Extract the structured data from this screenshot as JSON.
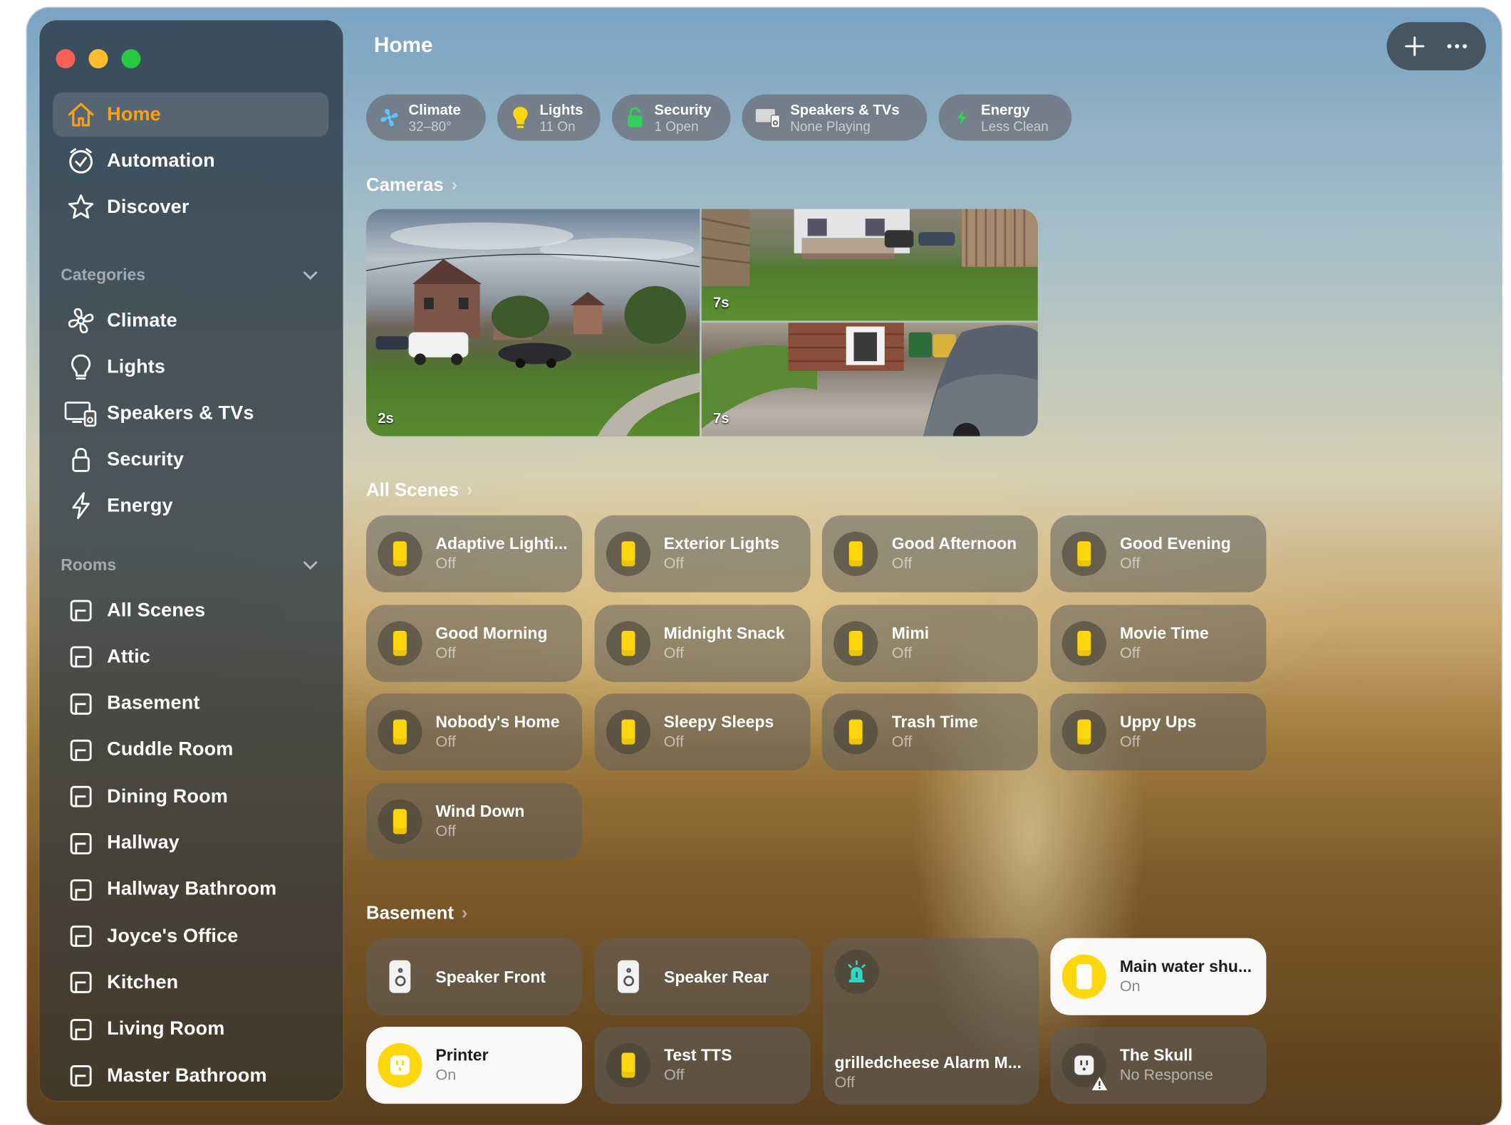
{
  "window": {
    "title": "Home"
  },
  "colors": {
    "accent": "#ff9f0a",
    "scene_bulb": "#ffd60a",
    "close": "#ff5f57",
    "minimize": "#febc2e",
    "zoom": "#28c840"
  },
  "toolbar": {
    "add_icon": "plus-icon",
    "more_icon": "ellipsis-icon"
  },
  "sidebar": {
    "main": [
      {
        "label": "Home",
        "icon": "house-icon"
      },
      {
        "label": "Automation",
        "icon": "clock-check-icon"
      },
      {
        "label": "Discover",
        "icon": "star-icon"
      }
    ],
    "categories_header": "Categories",
    "categories": [
      {
        "label": "Climate",
        "icon": "fan-icon"
      },
      {
        "label": "Lights",
        "icon": "bulb-icon"
      },
      {
        "label": "Speakers & TVs",
        "icon": "tv-speaker-icon"
      },
      {
        "label": "Security",
        "icon": "lock-icon"
      },
      {
        "label": "Energy",
        "icon": "bolt-icon"
      }
    ],
    "rooms_header": "Rooms",
    "rooms": [
      "All Scenes",
      "Attic",
      "Basement",
      "Cuddle Room",
      "Dining Room",
      "Hallway",
      "Hallway Bathroom",
      "Joyce's Office",
      "Kitchen",
      "Living Room",
      "Master Bathroom"
    ]
  },
  "summary": [
    {
      "title": "Climate",
      "status": "32–80°",
      "icon": "fan-icon"
    },
    {
      "title": "Lights",
      "status": "11 On",
      "icon": "bulb-icon"
    },
    {
      "title": "Security",
      "status": "1 Open",
      "icon": "lock-icon"
    },
    {
      "title": "Speakers & TVs",
      "status": "None Playing",
      "icon": "tv-speaker-icon"
    },
    {
      "title": "Energy",
      "status": "Less Clean",
      "icon": "bolt-icon"
    }
  ],
  "cameras": {
    "header": "Cameras",
    "feeds": [
      {
        "age": "2s"
      },
      {
        "age": "7s"
      },
      {
        "age": "7s"
      }
    ]
  },
  "scenes": {
    "header": "All Scenes",
    "items": [
      {
        "name": "Adaptive Lighti...",
        "state": "Off"
      },
      {
        "name": "Exterior Lights",
        "state": "Off"
      },
      {
        "name": "Good Afternoon",
        "state": "Off"
      },
      {
        "name": "Good Evening",
        "state": "Off"
      },
      {
        "name": "Good Morning",
        "state": "Off"
      },
      {
        "name": "Midnight Snack",
        "state": "Off"
      },
      {
        "name": "Mimi",
        "state": "Off"
      },
      {
        "name": "Movie Time",
        "state": "Off"
      },
      {
        "name": "Nobody's Home",
        "state": "Off"
      },
      {
        "name": "Sleepy Sleeps",
        "state": "Off"
      },
      {
        "name": "Trash Time",
        "state": "Off"
      },
      {
        "name": "Uppy Ups",
        "state": "Off"
      },
      {
        "name": "Wind Down",
        "state": "Off"
      }
    ]
  },
  "basement": {
    "header": "Basement",
    "items": [
      {
        "name": "Speaker Front",
        "icon": "speaker-icon"
      },
      {
        "name": "Speaker Rear",
        "icon": "speaker-icon"
      },
      {
        "name": "grilledcheese Alarm M...",
        "state": "Off",
        "icon": "siren-icon"
      },
      {
        "name": "Main water shu...",
        "state": "On",
        "icon": "valve-icon"
      },
      {
        "name": "Printer",
        "state": "On",
        "icon": "outlet-icon"
      },
      {
        "name": "Test TTS",
        "state": "Off",
        "icon": "bulb-icon"
      },
      {
        "name": "The Skull",
        "state": "No Response",
        "icon": "outlet-warning-icon"
      }
    ]
  }
}
